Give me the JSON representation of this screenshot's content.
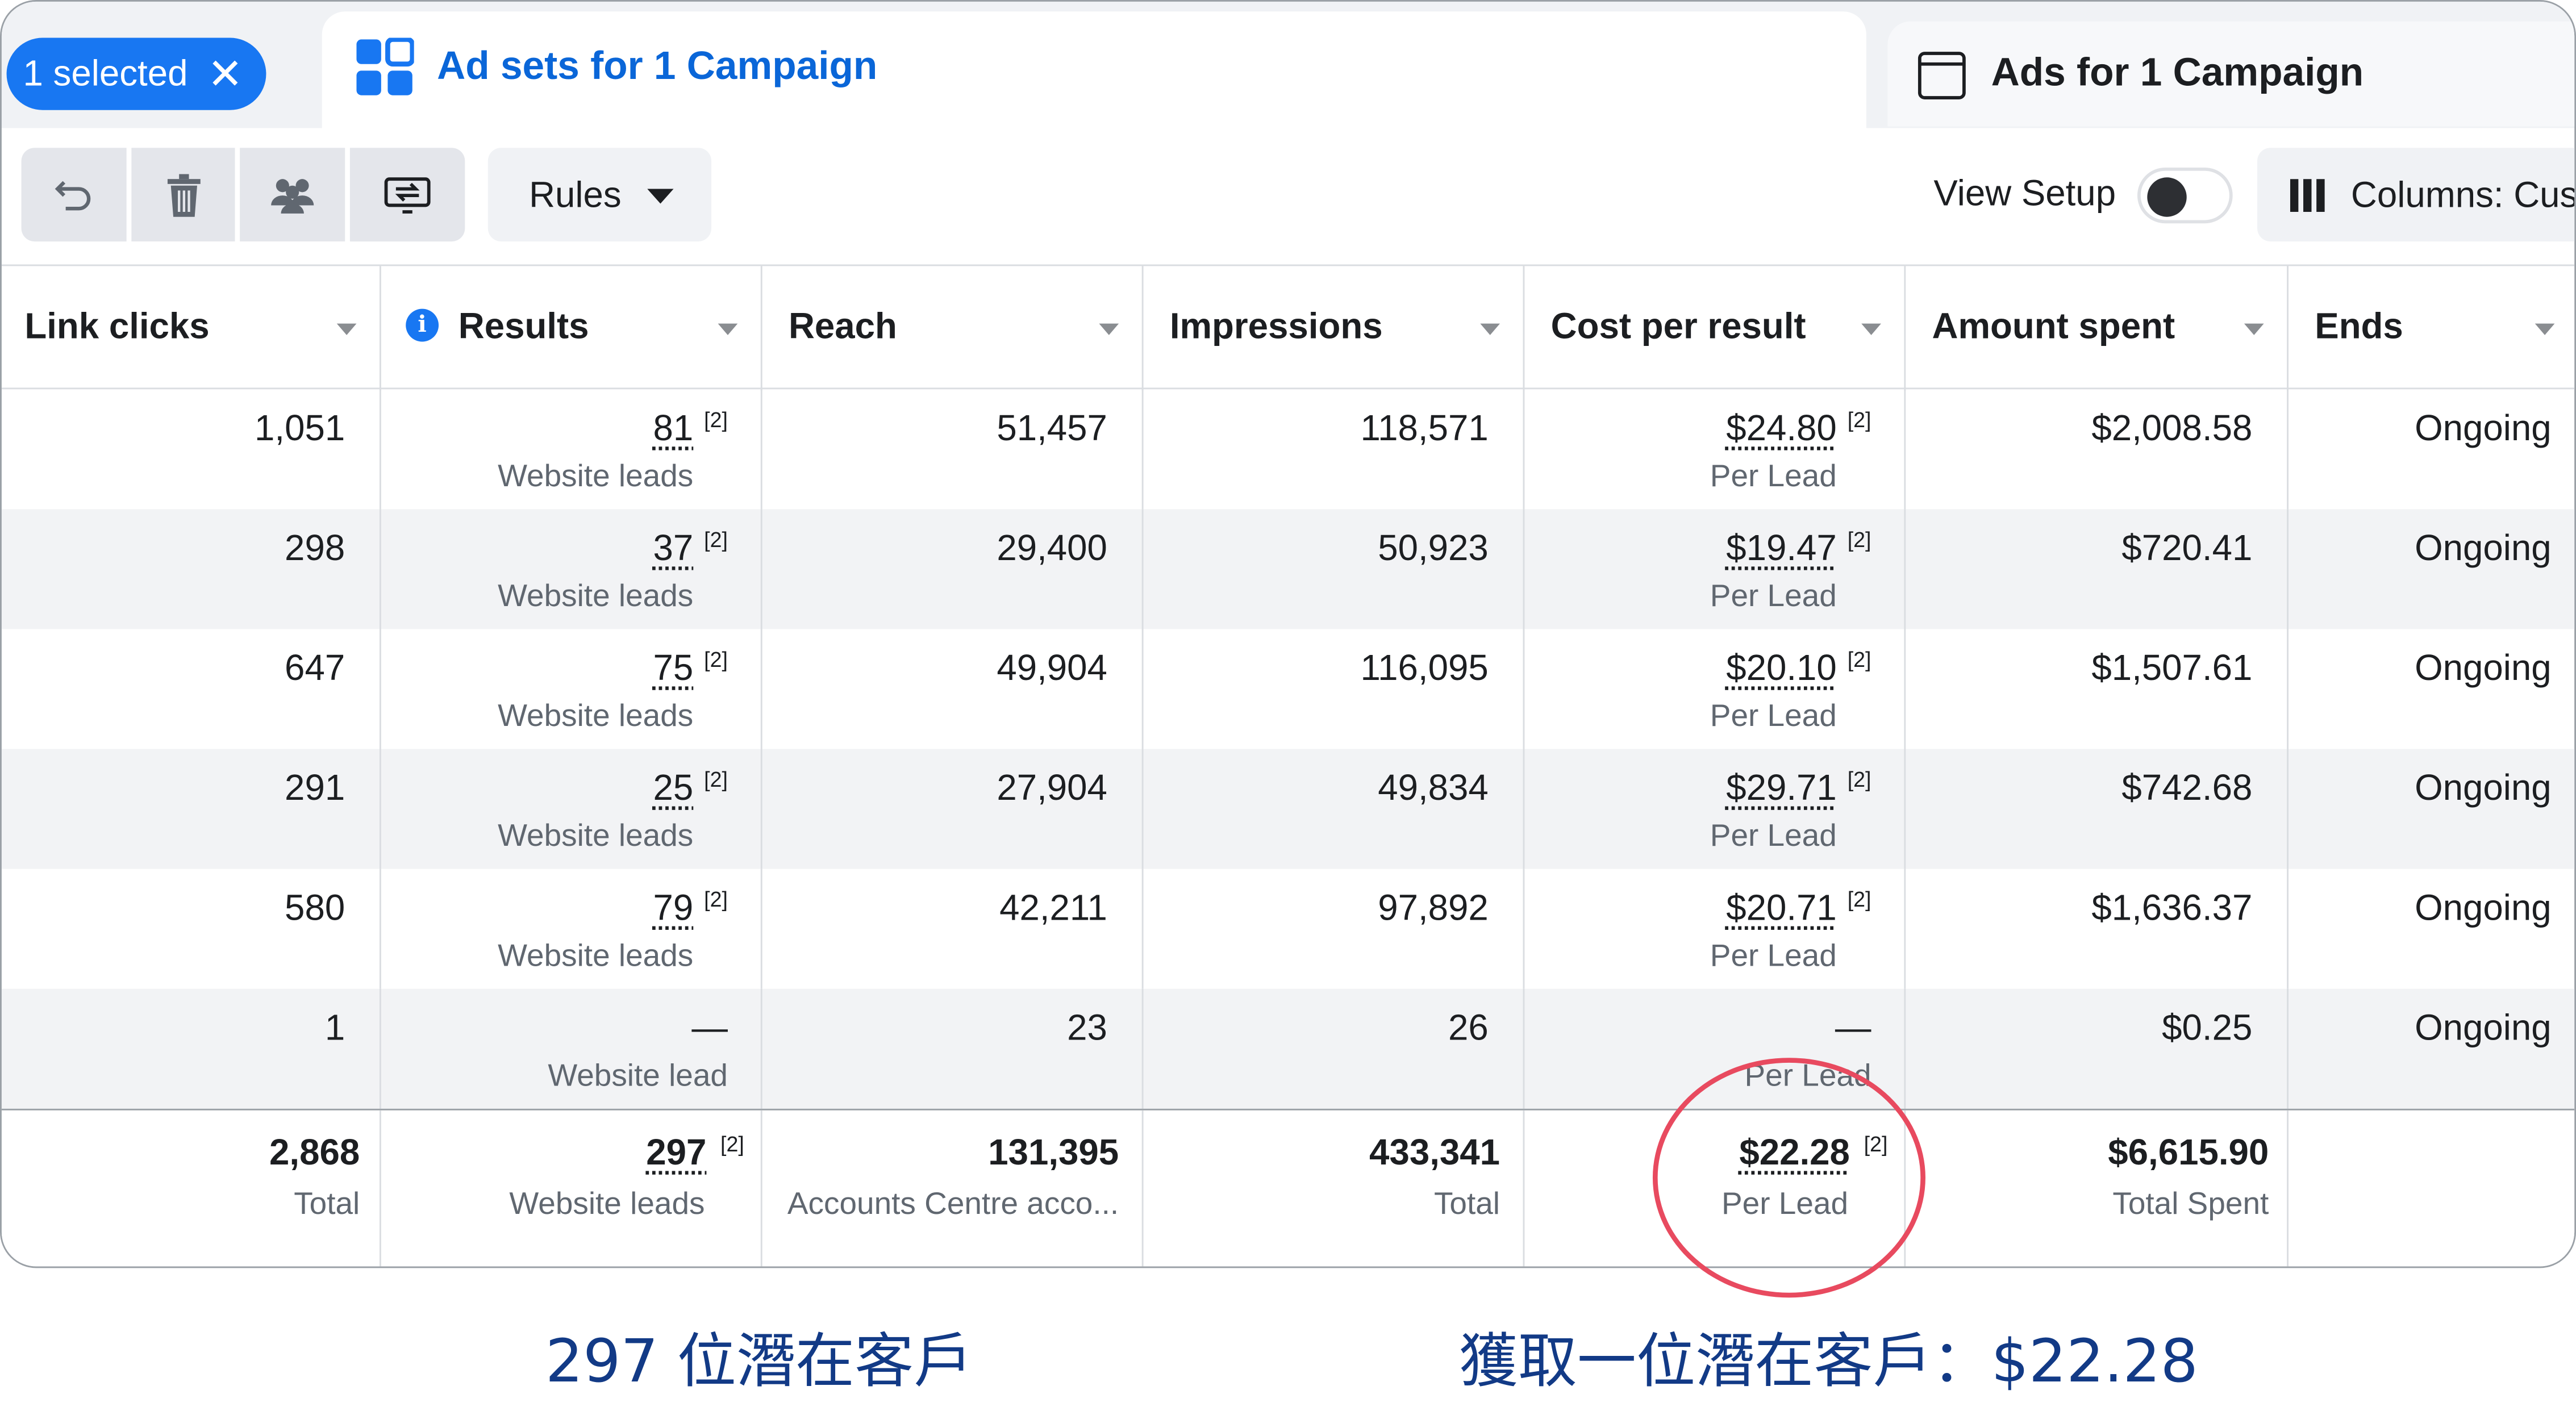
{
  "tabs": {
    "selected_label": "1 selected",
    "adsets_label": "Ad sets for 1 Campaign",
    "ads_label": "Ads for 1 Campaign"
  },
  "toolbar": {
    "rules_label": "Rules",
    "view_setup_label": "View Setup",
    "view_setup_on": false,
    "columns_label": "Columns: Cus"
  },
  "table": {
    "headers": [
      "Link clicks",
      "Results",
      "Reach",
      "Impressions",
      "Cost per result",
      "Amount spent",
      "Ends"
    ],
    "rows": [
      {
        "link_clicks": "1,051",
        "results": "81",
        "results_sub": "Website leads",
        "reach": "51,457",
        "impressions": "118,571",
        "cpr": "$24.80",
        "cpr_sub": "Per Lead",
        "spent": "$2,008.58",
        "ends": "Ongoing"
      },
      {
        "link_clicks": "298",
        "results": "37",
        "results_sub": "Website leads",
        "reach": "29,400",
        "impressions": "50,923",
        "cpr": "$19.47",
        "cpr_sub": "Per Lead",
        "spent": "$720.41",
        "ends": "Ongoing"
      },
      {
        "link_clicks": "647",
        "results": "75",
        "results_sub": "Website leads",
        "reach": "49,904",
        "impressions": "116,095",
        "cpr": "$20.10",
        "cpr_sub": "Per Lead",
        "spent": "$1,507.61",
        "ends": "Ongoing"
      },
      {
        "link_clicks": "291",
        "results": "25",
        "results_sub": "Website leads",
        "reach": "27,904",
        "impressions": "49,834",
        "cpr": "$29.71",
        "cpr_sub": "Per Lead",
        "spent": "$742.68",
        "ends": "Ongoing"
      },
      {
        "link_clicks": "580",
        "results": "79",
        "results_sub": "Website leads",
        "reach": "42,211",
        "impressions": "97,892",
        "cpr": "$20.71",
        "cpr_sub": "Per Lead",
        "spent": "$1,636.37",
        "ends": "Ongoing"
      },
      {
        "link_clicks": "1",
        "results": "—",
        "results_sub": "Website lead",
        "reach": "23",
        "impressions": "26",
        "cpr": "—",
        "cpr_sub": "Per Lead",
        "spent": "$0.25",
        "ends": "Ongoing"
      }
    ],
    "sup_marker": "[2]",
    "totals": {
      "link_clicks": "2,868",
      "link_clicks_sub": "Total",
      "results": "297",
      "results_sub": "Website leads",
      "reach": "131,395",
      "reach_sub": "Accounts Centre acco...",
      "impressions": "433,341",
      "impressions_sub": "Total",
      "cpr": "$22.28",
      "cpr_sub": "Per Lead",
      "spent": "$6,615.90",
      "spent_sub": "Total Spent"
    }
  },
  "captions": {
    "left": "297 位潛在客戶",
    "right": "獲取一位潛在客戶：$22.28"
  },
  "colors": {
    "accent_blue": "#1877f2",
    "caption_navy": "#123a86",
    "highlight_circle": "#e84a5f"
  }
}
